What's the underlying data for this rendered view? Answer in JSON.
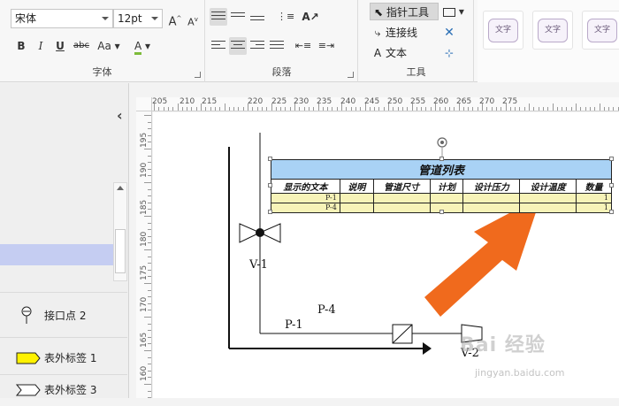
{
  "ribbon": {
    "font_group": {
      "label": "字体",
      "font_name": "宋体",
      "font_size": "12pt",
      "grow_label": "A",
      "shrink_label": "A",
      "bold": "B",
      "italic": "I",
      "underline": "U",
      "strike": "abc",
      "case": "Aa",
      "color_a": "A"
    },
    "para_group": {
      "label": "段落"
    },
    "tools_group": {
      "label": "工具",
      "pointer": "指针工具",
      "connector": "连接线",
      "text": "文本"
    },
    "styles": [
      "文字",
      "文字",
      "文字"
    ]
  },
  "left_panel": {
    "collapse_glyph": "‹",
    "items": [
      {
        "label": "接口点 2"
      },
      {
        "label": "表外标签 1"
      },
      {
        "label": "表外标签 3"
      }
    ]
  },
  "ruler": {
    "h_labels": [
      "205",
      "210",
      "215",
      "220",
      "225",
      "230",
      "235",
      "240",
      "245",
      "250",
      "255",
      "260",
      "265",
      "270",
      "275"
    ],
    "v_labels": [
      "195",
      "190",
      "185",
      "180",
      "175",
      "170",
      "165",
      "160"
    ]
  },
  "pipe_table": {
    "title": "管道列表",
    "headers": [
      "显示的文本",
      "说明",
      "管道尺寸",
      "计划",
      "设计压力",
      "设计温度",
      "数量"
    ],
    "rows": [
      [
        "P-1",
        "",
        "",
        "",
        "",
        "",
        "1"
      ],
      [
        "P-4",
        "",
        "",
        "",
        "",
        "",
        "1"
      ]
    ]
  },
  "canvas_labels": {
    "v1": "V-1",
    "v2": "V-2",
    "p1": "P-1",
    "p4": "P-4"
  },
  "watermark": {
    "brand": "Bai 经验",
    "url": "jingyan.baidu.com"
  },
  "colors": {
    "table_title_bg": "#a9d2f5",
    "table_row_bg": "#f7f3b8",
    "arrow_orange": "#f06a1d",
    "selection_band": "#c5cdf2",
    "tag_yellow": "#fff200"
  }
}
